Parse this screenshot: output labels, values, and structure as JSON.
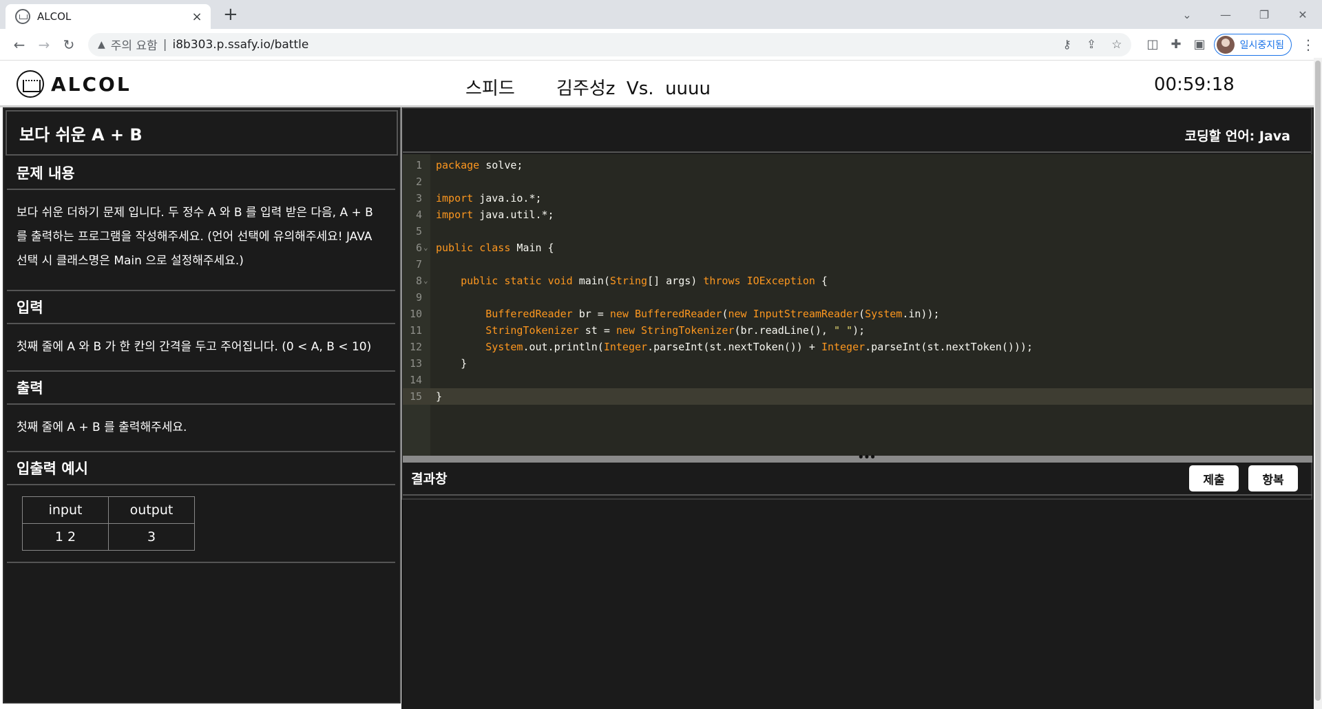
{
  "browser": {
    "tab_title": "ALCOL",
    "tab_close": "×",
    "new_tab": "+",
    "security_warning": "주의 요함",
    "url": "i8b303.p.ssafy.io/battle",
    "profile_label": "일시중지됨",
    "icons": [
      "back-icon",
      "forward-icon",
      "reload-icon",
      "warning-icon",
      "key-icon",
      "share-icon",
      "star-icon",
      "extension-icon",
      "puzzle-icon",
      "sidepanel-icon",
      "menu-icon"
    ]
  },
  "header": {
    "logo_text": "ALCOL",
    "mode": "스피드",
    "matchup": "김주성z  Vs.  uuuu",
    "timer": "00:59:18"
  },
  "problem": {
    "title": "보다 쉬운 A + B",
    "content_heading": "문제 내용",
    "content": "보다 쉬운 더하기 문제 입니다. 두 정수 A 와 B 를 입력 받은 다음, A + B 를 출력하는 프로그램을 작성해주세요. (언어 선택에 유의해주세요! JAVA 선택 시 클래스명은 Main 으로 설정해주세요.)",
    "input_heading": "입력",
    "input_desc": "첫째 줄에 A 와 B 가 한 칸의 간격을 두고 주어집니다. (0 < A, B < 10)",
    "output_heading": "출력",
    "output_desc": "첫째 줄에 A + B 를 출력해주세요.",
    "examples_heading": "입출력 예시",
    "examples_headers": [
      "input",
      "output"
    ],
    "examples_rows": [
      [
        "1 2",
        "3"
      ]
    ]
  },
  "editor": {
    "language_label": "코딩할 언어: Java",
    "active_line": 15,
    "lines": [
      "package solve;",
      "",
      "import java.io.*;",
      "import java.util.*;",
      "",
      "public class Main {",
      "",
      "    public static void main(String[] args) throws IOException {",
      "",
      "        BufferedReader br = new BufferedReader(new InputStreamReader(System.in));",
      "        StringTokenizer st = new StringTokenizer(br.readLine(), \" \");",
      "        System.out.println(Integer.parseInt(st.nextToken()) + Integer.parseInt(st.nextToken()));",
      "    }",
      "",
      "}"
    ],
    "fold_lines": [
      6,
      8
    ],
    "splitter_glyph": "•••"
  },
  "result": {
    "heading": "결과창",
    "submit_label": "제출",
    "surrender_label": "항복"
  }
}
